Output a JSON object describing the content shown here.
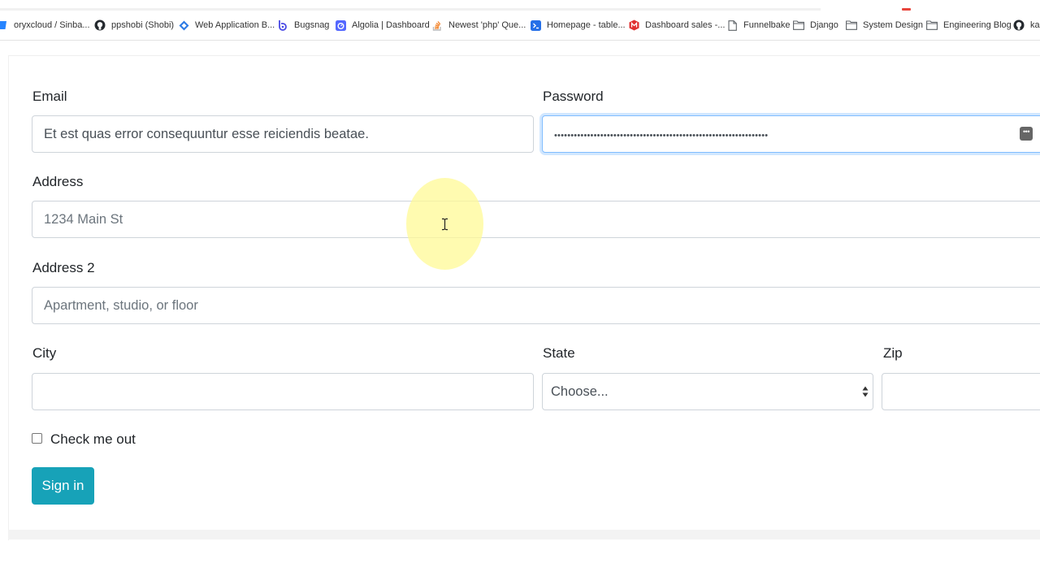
{
  "bookmarks": [
    {
      "label": "oryxcloud / Sinba...",
      "icon": "bitbucket-icon",
      "color": "#2684ff"
    },
    {
      "label": "ppshobi (Shobi)",
      "icon": "github-icon",
      "color": "#24292e"
    },
    {
      "label": "Web Application B...",
      "icon": "diamond-icon",
      "color": "#2d7be5"
    },
    {
      "label": "Bugsnag",
      "icon": "bugsnag-icon",
      "color": "#4949e4"
    },
    {
      "label": "Algolia | Dashboard",
      "icon": "algolia-icon",
      "color": "#5468ff"
    },
    {
      "label": "Newest 'php' Que...",
      "icon": "stackoverflow-icon",
      "color": "#f48024"
    },
    {
      "label": "Homepage - table...",
      "icon": "terminal-icon",
      "color": "#2670e8"
    },
    {
      "label": "Dashboard sales -...",
      "icon": "metabase-icon",
      "color": "#e03030"
    },
    {
      "label": "Funnelbake",
      "icon": "page-icon",
      "color": "#5f6368"
    },
    {
      "label": "Django",
      "icon": "folder-icon",
      "color": "#5f6368"
    },
    {
      "label": "System Design",
      "icon": "folder-icon",
      "color": "#5f6368"
    },
    {
      "label": "Engineering Blog",
      "icon": "folder-icon",
      "color": "#5f6368"
    },
    {
      "label": "kar",
      "icon": "github-icon",
      "color": "#24292e"
    }
  ],
  "form": {
    "email": {
      "label": "Email",
      "value": "Et est quas error consequuntur esse reiciendis beatae."
    },
    "password": {
      "label": "Password",
      "value": "•••••••••••••••••••••••••••••••••••••••••••••••••••••••••••••••••"
    },
    "address": {
      "label": "Address",
      "placeholder": "1234 Main St"
    },
    "address2": {
      "label": "Address 2",
      "placeholder": "Apartment, studio, or floor"
    },
    "city": {
      "label": "City",
      "value": ""
    },
    "state": {
      "label": "State",
      "selected": "Choose..."
    },
    "zip": {
      "label": "Zip",
      "value": ""
    },
    "check": {
      "label": "Check me out"
    },
    "submit": {
      "label": "Sign in"
    }
  },
  "colors": {
    "primary_button": "#17a2b8",
    "focus_border": "#80bdff",
    "input_border": "#ced4da"
  }
}
